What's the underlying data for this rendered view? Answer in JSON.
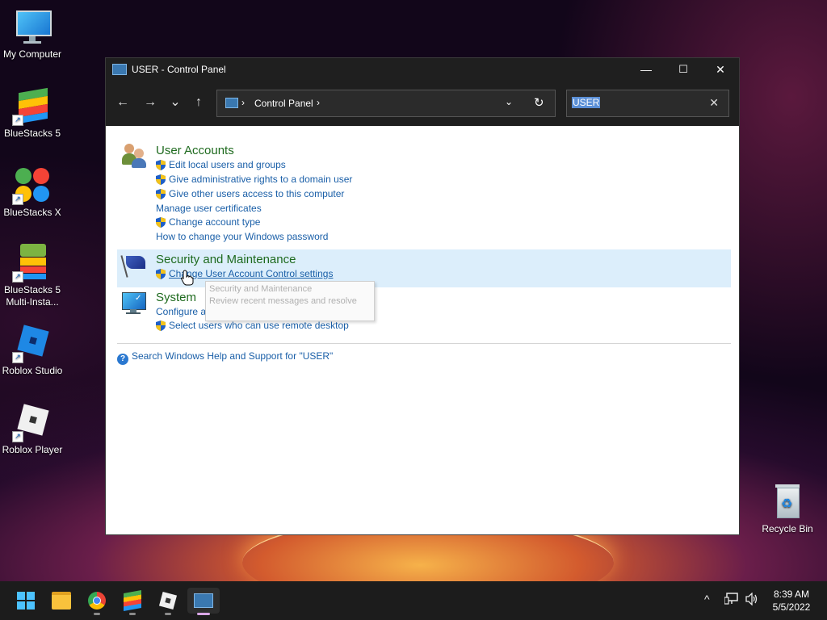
{
  "desktop": {
    "icons": [
      {
        "label": "My Computer",
        "icon": "monitor-icon"
      },
      {
        "label": "BlueStacks 5",
        "icon": "bluestacks-icon"
      },
      {
        "label": "BlueStacks X",
        "icon": "bluestacks-x-icon"
      },
      {
        "label": "BlueStacks 5 Multi-Insta...",
        "icon": "bluestacks-multi-icon"
      },
      {
        "label": "Roblox Studio",
        "icon": "roblox-studio-icon"
      },
      {
        "label": "Roblox Player",
        "icon": "roblox-player-icon"
      },
      {
        "label": "Recycle Bin",
        "icon": "recycle-bin-icon"
      }
    ]
  },
  "window": {
    "title": "USER - Control Panel",
    "controls": {
      "minimize": "—",
      "maximize": "☐",
      "close": "✕"
    },
    "nav": {
      "back": "←",
      "forward": "→",
      "recent": "⌄",
      "up": "↑"
    },
    "address": {
      "separator": "›",
      "crumb": "Control Panel",
      "dropdown": "⌄",
      "refresh": "↻"
    },
    "search": {
      "value": "USER",
      "clear": "✕"
    }
  },
  "results": {
    "user_accounts": {
      "heading": "User Accounts",
      "links": [
        "Edit local users and groups",
        "Give administrative rights to a domain user",
        "Give other users access to this computer",
        "Manage user certificates",
        "Change account type",
        "How to change your Windows password"
      ]
    },
    "security": {
      "heading": "Security and Maintenance",
      "links": [
        "Change User Account Control settings"
      ]
    },
    "system": {
      "heading": "System",
      "links": [
        "Configure advanced user profile properties",
        "Select users who can use remote desktop"
      ]
    },
    "tooltip": {
      "title": "Security and Maintenance",
      "text": "Review recent messages and resolve"
    },
    "help_link": "Search Windows Help and Support for \"USER\""
  },
  "taskbar": {
    "apps": [
      "start-icon",
      "file-explorer-icon",
      "chrome-icon",
      "bluestacks-icon",
      "roblox-icon",
      "control-panel-icon"
    ],
    "tray": {
      "chevron": "^"
    },
    "clock": {
      "time": "8:39 AM",
      "date": "5/5/2022"
    }
  }
}
